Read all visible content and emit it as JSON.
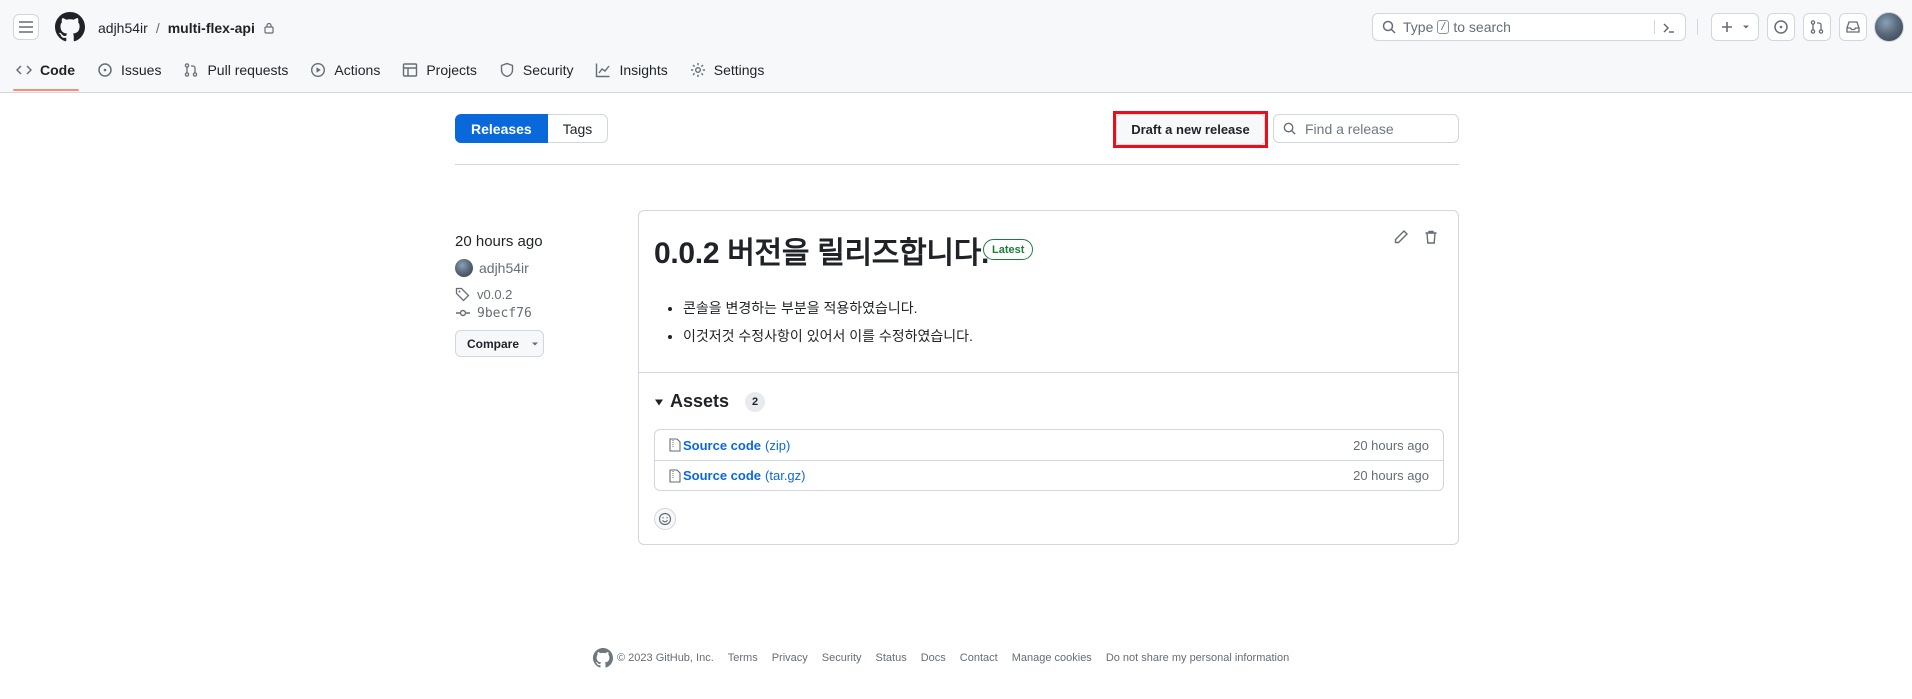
{
  "header": {
    "owner": "adjh54ir",
    "separator": "/",
    "repo": "multi-flex-api",
    "search": {
      "prefix": "Type",
      "key": "/",
      "suffix": "to search"
    }
  },
  "tabs": [
    {
      "label": "Code",
      "icon": "code-icon"
    },
    {
      "label": "Issues",
      "icon": "issue-icon"
    },
    {
      "label": "Pull requests",
      "icon": "pull-request-icon"
    },
    {
      "label": "Actions",
      "icon": "play-icon"
    },
    {
      "label": "Projects",
      "icon": "table-icon"
    },
    {
      "label": "Security",
      "icon": "shield-icon"
    },
    {
      "label": "Insights",
      "icon": "graph-icon"
    },
    {
      "label": "Settings",
      "icon": "gear-icon"
    }
  ],
  "toolbar": {
    "releases_label": "Releases",
    "tags_label": "Tags",
    "draft_label": "Draft a new release",
    "find_placeholder": "Find a release"
  },
  "release": {
    "time": "20 hours ago",
    "author": "adjh54ir",
    "tag": "v0.0.2",
    "commit": "9becf76",
    "compare_label": "Compare",
    "title": "0.0.2 버전을 릴리즈합니다.",
    "badge": "Latest",
    "notes": [
      "콘솔을 변경하는 부분을 적용하였습니다.",
      "이것저것 수정사항이 있어서 이를 수정하였습니다."
    ],
    "assets_label": "Assets",
    "assets_count": "2",
    "assets": [
      {
        "name": "Source code",
        "ext": "(zip)",
        "time": "20 hours ago"
      },
      {
        "name": "Source code",
        "ext": "(tar.gz)",
        "time": "20 hours ago"
      }
    ]
  },
  "footer": {
    "copyright": "© 2023 GitHub, Inc.",
    "links": [
      "Terms",
      "Privacy",
      "Security",
      "Status",
      "Docs",
      "Contact",
      "Manage cookies",
      "Do not share my personal information"
    ]
  },
  "colors": {
    "accent": "#0969da",
    "latest_green": "#1a7f37",
    "highlight_red": "#e5101c",
    "tab_underline": "#fd8c73"
  }
}
